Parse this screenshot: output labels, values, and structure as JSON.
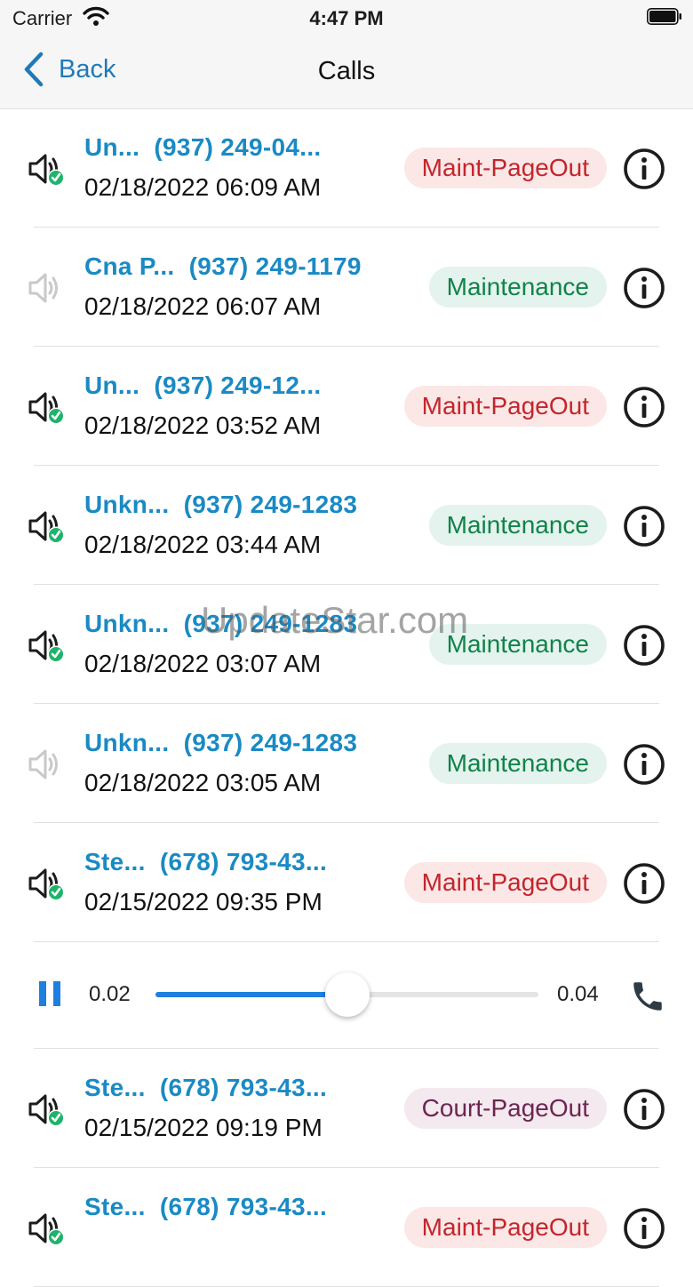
{
  "status_bar": {
    "carrier": "Carrier",
    "time": "4:47 PM"
  },
  "nav": {
    "back_label": "Back",
    "title": "Calls"
  },
  "calls": [
    {
      "name": "Un...",
      "number": "(937) 249-04...",
      "datetime": "02/18/2022 06:09 AM",
      "tag": "Maint-PageOut",
      "tag_type": "pageout",
      "listened": true
    },
    {
      "name": "Cna P...",
      "number": "(937) 249-1179",
      "datetime": "02/18/2022 06:07 AM",
      "tag": "Maintenance",
      "tag_type": "maint",
      "listened": false
    },
    {
      "name": "Un...",
      "number": "(937) 249-12...",
      "datetime": "02/18/2022 03:52 AM",
      "tag": "Maint-PageOut",
      "tag_type": "pageout",
      "listened": true
    },
    {
      "name": "Unkn...",
      "number": "(937) 249-1283",
      "datetime": "02/18/2022 03:44 AM",
      "tag": "Maintenance",
      "tag_type": "maint",
      "listened": true
    },
    {
      "name": "Unkn...",
      "number": "(937) 249-1283",
      "datetime": "02/18/2022 03:07 AM",
      "tag": "Maintenance",
      "tag_type": "maint",
      "listened": true
    },
    {
      "name": "Unkn...",
      "number": "(937) 249-1283",
      "datetime": "02/18/2022 03:05 AM",
      "tag": "Maintenance",
      "tag_type": "maint",
      "listened": false
    },
    {
      "name": "Ste...",
      "number": "(678) 793-43...",
      "datetime": "02/15/2022 09:35 PM",
      "tag": "Maint-PageOut",
      "tag_type": "pageout",
      "listened": true
    },
    {
      "name": "Ste...",
      "number": "(678) 793-43...",
      "datetime": "02/15/2022 09:19 PM",
      "tag": "Court-PageOut",
      "tag_type": "court",
      "listened": true
    },
    {
      "name": "Ste...",
      "number": "(678) 793-43...",
      "datetime": "",
      "tag": "Maint-PageOut",
      "tag_type": "pageout",
      "listened": true
    }
  ],
  "player": {
    "position": "0.02",
    "duration": "0.04",
    "progress": 0.5,
    "after_row": 6
  },
  "watermark": "UpdateStar.com",
  "colors": {
    "link": "#1a8ac4",
    "accent": "#1d7fe0",
    "check": "#1fb36b"
  }
}
